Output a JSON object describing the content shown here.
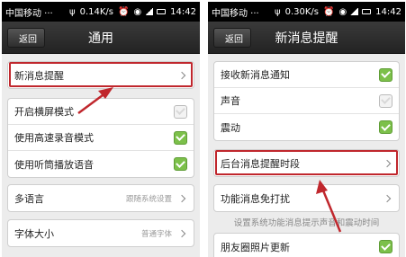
{
  "left": {
    "status": {
      "carrier": "中国移动 ···",
      "usb": "ψ",
      "speed": "0.14K/s",
      "alarm": "⏰",
      "wifi": "◉",
      "time": "14:42"
    },
    "back_label": "返回",
    "title": "通用",
    "groups": {
      "notify": {
        "label": "新消息提醒"
      },
      "toggles": [
        {
          "label": "开启横屏模式",
          "checked": false
        },
        {
          "label": "使用高速录音模式",
          "checked": true
        },
        {
          "label": "使用听筒播放语音",
          "checked": true
        }
      ],
      "language": {
        "label": "多语言",
        "value": "跟随系统设置"
      },
      "font": {
        "label": "字体大小",
        "value": "普通字体"
      }
    }
  },
  "right": {
    "status": {
      "carrier": "中国移动 ···",
      "usb": "ψ",
      "speed": "0.30K/s",
      "alarm": "⏰",
      "wifi": "◉",
      "time": "14:42"
    },
    "back_label": "返回",
    "title": "新消息提醒",
    "toggles": [
      {
        "label": "接收新消息通知",
        "checked": true
      },
      {
        "label": "声音",
        "checked": false
      },
      {
        "label": "震动",
        "checked": true
      }
    ],
    "background_period": {
      "label": "后台消息提醒时段"
    },
    "dnd": {
      "label": "功能消息免打扰"
    },
    "hint": "设置系统功能消息提示声音和震动时间",
    "moments": {
      "label": "朋友圈照片更新"
    }
  },
  "colors": {
    "highlight": "#c0272d",
    "check_on": "#7cc04a",
    "titlebar": "#2a2a2a"
  }
}
